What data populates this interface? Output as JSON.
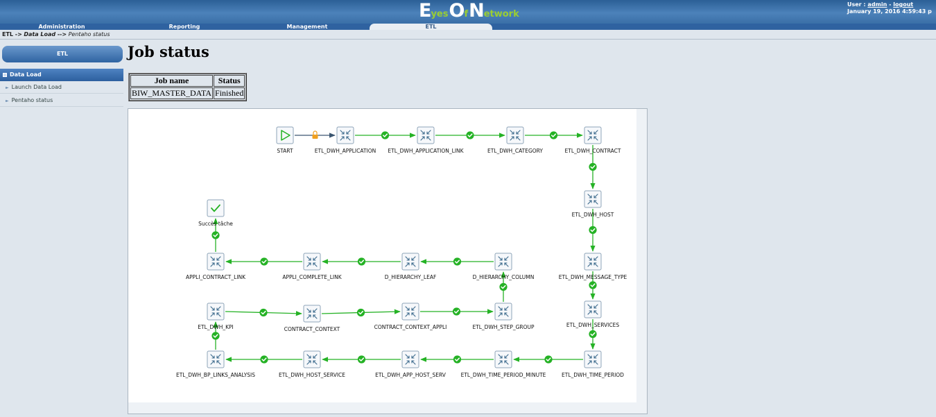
{
  "header": {
    "logo": {
      "big_e": "E",
      "yes": "yes",
      "big_o": "O",
      "f": "f",
      "big_n": "N",
      "etwork": "etwork"
    },
    "user_label": "User :",
    "user_name": "admin",
    "separator": "-",
    "logout": "logout",
    "datetime": "January 19, 2016 4:59:43 p"
  },
  "nav": {
    "tabs": [
      "Administration",
      "Reporting",
      "Management",
      "ETL"
    ],
    "active": "ETL"
  },
  "breadcrumb": {
    "part1": "ETL ->",
    "part2": "Data Load",
    "part3": "-->",
    "part4": "Pentaho status"
  },
  "sidebar": {
    "button": "ETL",
    "section": "Data Load",
    "items": [
      "Launch Data Load",
      "Pentaho status"
    ]
  },
  "main": {
    "title": "Job status",
    "table": {
      "headers": [
        "Job name",
        "Status"
      ],
      "rows": [
        [
          "BIW_MASTER_DATA",
          "Finished"
        ]
      ]
    }
  },
  "diagram": {
    "nodes": {
      "start": "START",
      "application": "ETL_DWH_APPLICATION",
      "application_link": "ETL_DWH_APPLICATION_LINK",
      "category": "ETL_DWH_CATEGORY",
      "contract": "ETL_DWH_CONTRACT",
      "host": "ETL_DWH_HOST",
      "message_type": "ETL_DWH_MESSAGE_TYPE",
      "services": "ETL_DWH_SERVICES",
      "time_period": "ETL_DWH_TIME_PERIOD",
      "time_period_minute": "ETL_DWH_TIME_PERIOD_MINUTE",
      "app_host_serv": "ETL_DWH_APP_HOST_SERV",
      "host_service": "ETL_DWH_HOST_SERVICE",
      "bp_links_analysis": "ETL_DWH_BP_LINKS_ANALYSIS",
      "kpi": "ETL_DWH_KPI",
      "contract_context": "CONTRACT_CONTEXT",
      "contract_context_appli": "CONTRACT_CONTEXT_APPLI",
      "step_group": "ETL_DWH_STEP_GROUP",
      "hierarchy_column": "D_HIERARCHY_COLUMN",
      "hierarchy_leaf": "D_HIERARCHY_LEAF",
      "appli_complete_link": "APPLI_COMPLETE_LINK",
      "appli_contract_link": "APPLI_CONTRACT_LINK",
      "success": "Succès tâche"
    },
    "colors": {
      "hop": "#25b225",
      "start_hop": "#3a5570",
      "lock": "#f0a020",
      "icon": "#3c6a8c"
    }
  }
}
